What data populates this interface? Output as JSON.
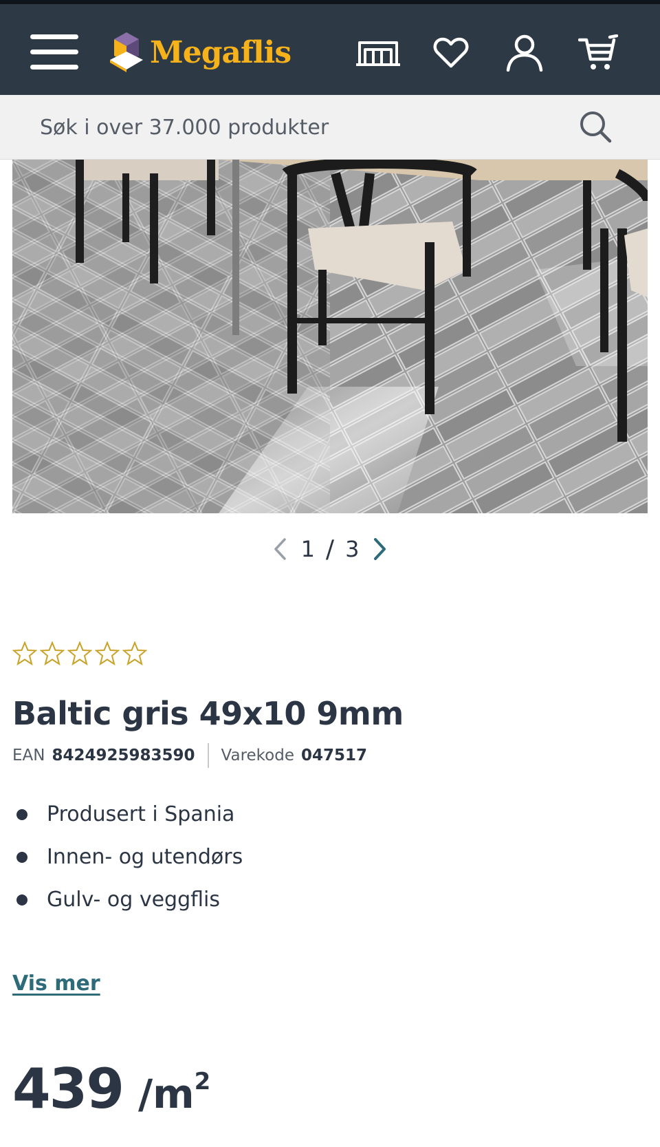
{
  "header": {
    "brand": "Megaflis",
    "colors": {
      "bar": "#2e3946",
      "brand": "#f5b21b"
    },
    "icons": [
      "menu-icon",
      "store-icon",
      "heart-icon",
      "user-icon",
      "cart-icon"
    ]
  },
  "search": {
    "placeholder": "Søk i over 37.000 produkter",
    "icon": "search-icon"
  },
  "gallery": {
    "current": "1",
    "separator": "/",
    "total": "3"
  },
  "product": {
    "rating": {
      "value": 0,
      "max": 5
    },
    "title": "Baltic gris 49x10 9mm",
    "ean_label": "EAN",
    "ean": "8424925983590",
    "sku_label": "Varekode",
    "sku": "047517",
    "features": [
      "Produsert i Spania",
      "Innen- og utendørs",
      "Gulv- og veggflis"
    ],
    "show_more": "Vis mer",
    "price": "439",
    "price_unit": "/m",
    "price_unit_sup": "2"
  }
}
